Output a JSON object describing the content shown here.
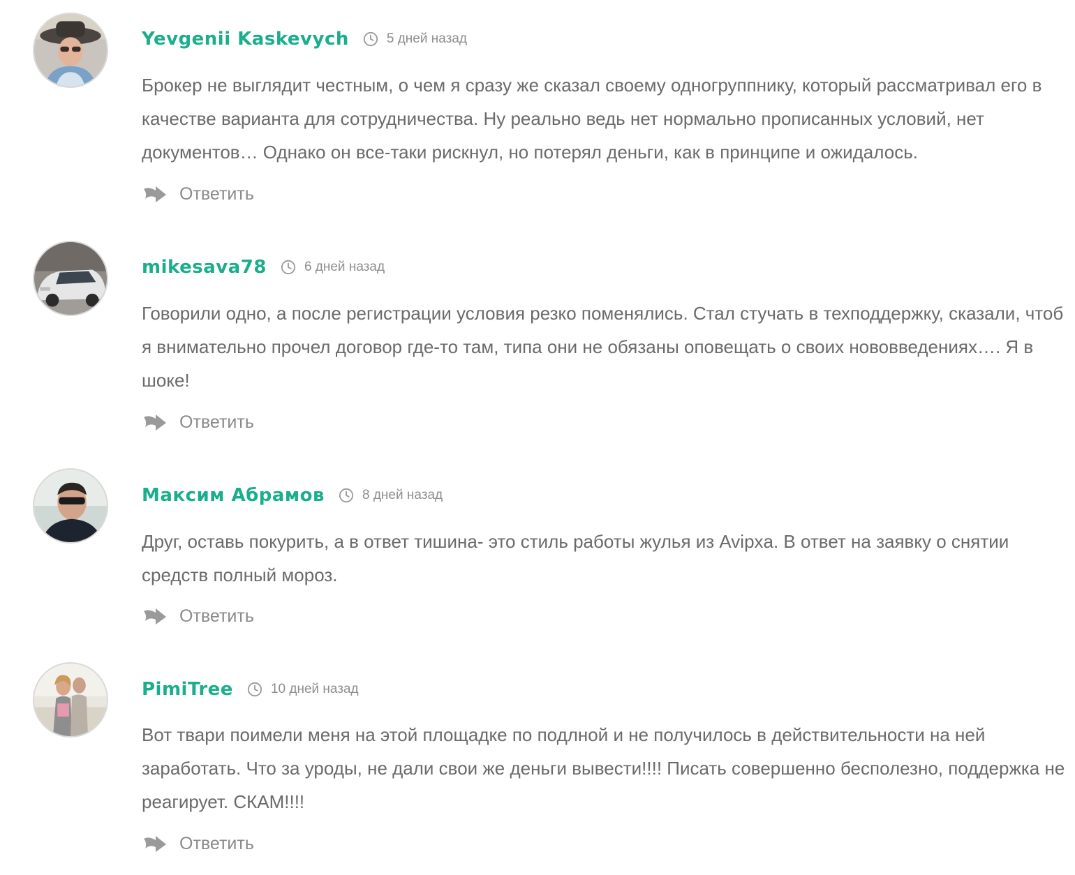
{
  "comments": [
    {
      "author": "Yevgenii Kaskevych",
      "time": "5 дней назад",
      "text": "Брокер не выглядит честным, о чем я сразу же сказал своему одногруппнику, который рассматривал его в качестве варианта для сотрудничества. Ну реально ведь нет нормально прописанных условий, нет документов… Однако он все-таки рискнул, но потерял деньги, как в принципе и ожидалось.",
      "reply_label": "Ответить"
    },
    {
      "author": "mikesava78",
      "time": "6 дней назад",
      "text": "Говорили одно, а после регистрации условия резко поменялись. Стал стучать в техподдержку, сказали, чтоб я внимательно прочел договор где-то там, типа они не обязаны оповещать о своих нововведениях…. Я в шоке!",
      "reply_label": "Ответить"
    },
    {
      "author": "Максим Абрамов",
      "time": "8 дней назад",
      "text": "Друг, оставь покурить, а в ответ тишина- это стиль работы жулья из Avipxa. В ответ на заявку о снятии средств полный мороз.",
      "reply_label": "Ответить"
    },
    {
      "author": "PimiTree",
      "time": "10 дней назад",
      "text": "Вот твари поимели меня на этой площадке по подлной и не получилось в действительности на ней заработать. Что за уроды, не дали свои же деньги вывести!!!! Писать совершенно бесполезно, поддержка не реагирует. СКАМ!!!!",
      "reply_label": "Ответить"
    }
  ],
  "colors": {
    "author": "#1aae8c",
    "text": "#6a6a6a",
    "meta": "#8d8d8d",
    "icon": "#9a9a9a"
  },
  "icons": {
    "time": "clock-icon",
    "reply": "reply-arrow-icon"
  }
}
